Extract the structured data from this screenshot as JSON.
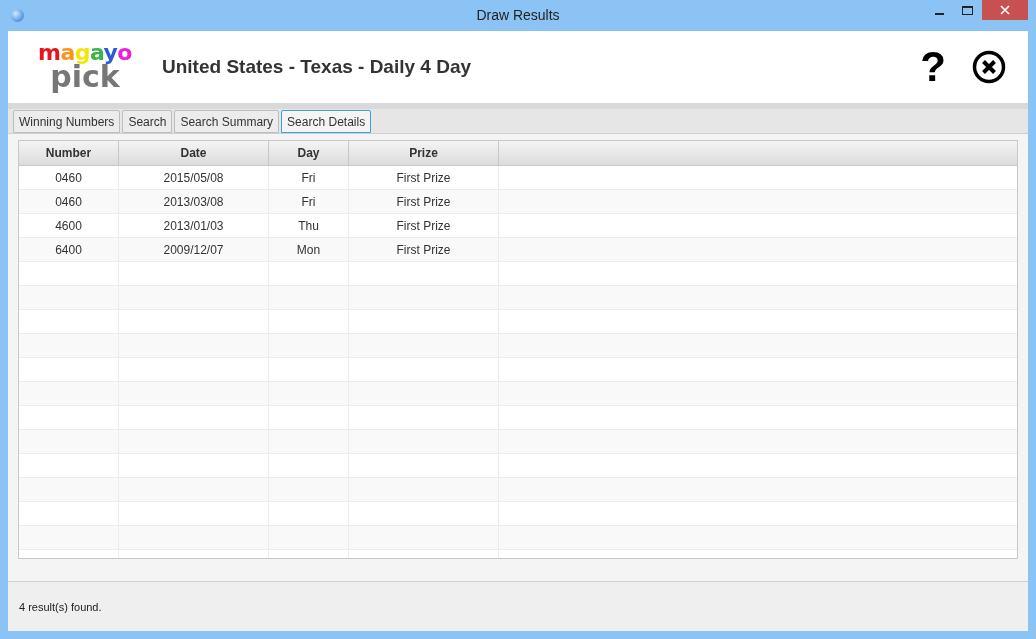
{
  "window": {
    "title": "Draw Results"
  },
  "logo": {
    "top": "magayo",
    "bottom": "pick"
  },
  "header": {
    "title": "United States - Texas - Daily 4 Day",
    "help": "?"
  },
  "tabs": [
    {
      "label": "Winning Numbers",
      "selected": false
    },
    {
      "label": "Search",
      "selected": false
    },
    {
      "label": "Search Summary",
      "selected": false
    },
    {
      "label": "Search Details",
      "selected": true
    }
  ],
  "table": {
    "columns": [
      "Number",
      "Date",
      "Day",
      "Prize"
    ],
    "rows": [
      [
        "0460",
        "2015/05/08",
        "Fri",
        "First Prize"
      ],
      [
        "0460",
        "2013/03/08",
        "Fri",
        "First Prize"
      ],
      [
        "4600",
        "2013/01/03",
        "Thu",
        "First Prize"
      ],
      [
        "6400",
        "2009/12/07",
        "Mon",
        "First Prize"
      ]
    ]
  },
  "status_bar": "4 result(s) found."
}
